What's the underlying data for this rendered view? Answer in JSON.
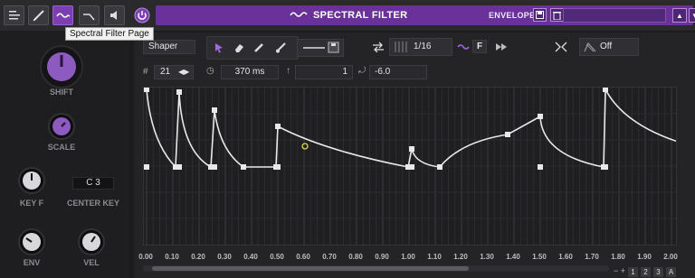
{
  "header": {
    "title": "SPECTRAL FILTER",
    "envelope_label": "ENVELOPE",
    "envelope_preset": ""
  },
  "tooltip": "Spectral Filter Page",
  "left": {
    "shift_label": "SHIFT",
    "scale_label": "SCALE",
    "keyf_label": "KEY F",
    "center_key_label": "CENTER KEY",
    "center_key_value": "C 3",
    "env_label": "ENV",
    "vel_label": "VEL"
  },
  "toolbar": {
    "mode": "Shaper",
    "grid": "1/16",
    "f_label": "F",
    "retrigger": "Off",
    "steps": "21",
    "time": "370 ms",
    "sustain": "1",
    "curve": "-6.0"
  },
  "graph": {
    "x_ticks": [
      "0.00",
      "0.10",
      "0.20",
      "0.30",
      "0.40",
      "0.50",
      "0.60",
      "0.70",
      "0.80",
      "0.90",
      "1.00",
      "1.10",
      "1.20",
      "1.30",
      "1.40",
      "1.50",
      "1.60",
      "1.70",
      "1.80",
      "1.90",
      "2.00"
    ],
    "pages": [
      "1",
      "2",
      "3",
      "A"
    ]
  },
  "colors": {
    "accent": "#7b3fb0",
    "title_bar": "#6a3199",
    "knob_cap": "#8d5bbf"
  }
}
